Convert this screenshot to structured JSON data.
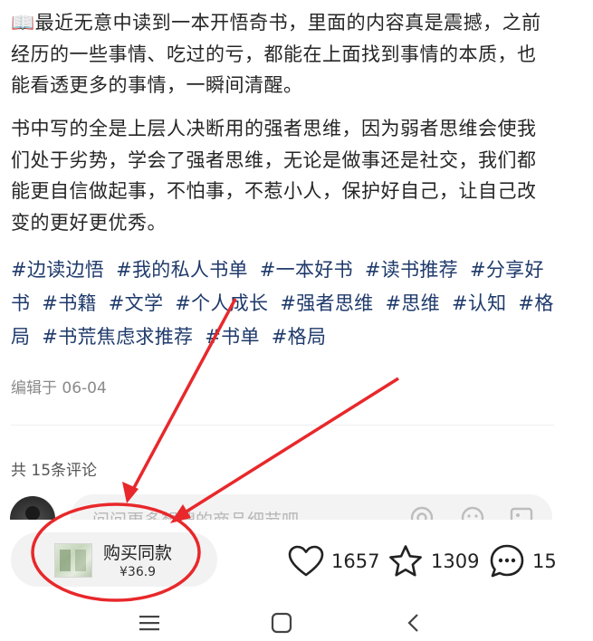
{
  "post": {
    "paragraph1": "📖最近无意中读到一本开悟奇书，里面的内容真是震撼，之前经历的一些事情、吃过的亏，都能在上面找到事情的本质，也能看透更多的事情，一瞬间清醒。",
    "paragraph2": "书中写的全是上层人决断用的强者思维，因为弱者思维会使我们处于劣势，学会了强者思维，无论是做事还是社交，我们都能更自信做起事，不怕事，不惹小人，保护好自己，让自己改变的更好更优秀。",
    "tags": [
      "#边读边悟",
      "#我的私人书单",
      "#一本好书",
      "#读书推荐",
      "#分享好书",
      "#书籍",
      "#文学",
      "#个人成长",
      "#强者思维",
      "#思维",
      "#认知",
      "#格局",
      "#书荒焦虑求推荐",
      "#书单",
      "#格局"
    ],
    "edited": "编辑于 06-04"
  },
  "comments": {
    "count_label": "共 15条评论",
    "input_placeholder": "问问更多想搜的商品细节吧"
  },
  "bottom_bar": {
    "buy_label": "购买同款",
    "buy_price": "¥36.9",
    "likes": "1657",
    "favorites": "1309",
    "comments": "15"
  },
  "icons": {
    "like": "heart-icon",
    "favorite": "star-icon",
    "comment": "comment-bubble-icon",
    "at": "at-icon",
    "emoji": "emoji-icon",
    "image": "image-icon",
    "menu": "menu-icon",
    "home": "home-icon",
    "back": "back-icon"
  },
  "colors": {
    "tag": "#1f3a6b",
    "annotation": "#e8282b"
  }
}
